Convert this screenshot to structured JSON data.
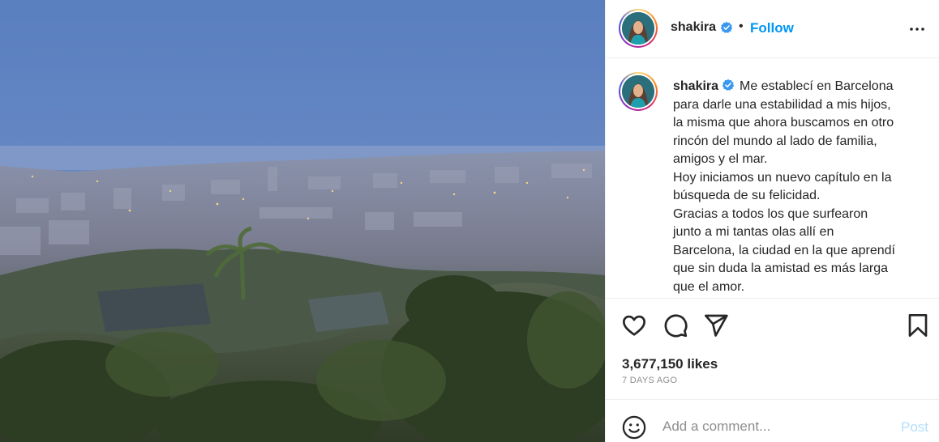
{
  "post": {
    "username": "shakira",
    "verified": true,
    "follow_label": "Follow",
    "separator": "•",
    "caption_lines": [
      "Me establecí en Barcelona",
      "para darle una estabilidad a mis hijos,",
      "la misma que ahora buscamos en otro",
      "rincón del mundo al lado de familia,",
      "amigos y el mar.",
      "Hoy iniciamos un nuevo capítulo en la",
      "búsqueda de su felicidad.",
      "Gracias a todos los que surfearon",
      "junto a mi tantas olas allí en",
      "Barcelona, la ciudad en la que aprendí",
      "que sin duda la amistad es más larga",
      "que el amor."
    ],
    "likes": "3,677,150 likes",
    "posted": "7 DAYS AGO"
  },
  "comment": {
    "placeholder": "Add a comment...",
    "post_label": "Post"
  },
  "icons": {
    "more": "more-options-icon",
    "like": "heart-icon",
    "comment": "comment-icon",
    "share": "share-icon",
    "save": "bookmark-icon",
    "emoji": "emoji-icon",
    "verified": "verified-badge-icon"
  },
  "colors": {
    "accent": "#0095f6",
    "verified": "#3897f0",
    "post_disabled": "#b2dffc",
    "muted": "#8e8e8e",
    "text": "#262626"
  }
}
